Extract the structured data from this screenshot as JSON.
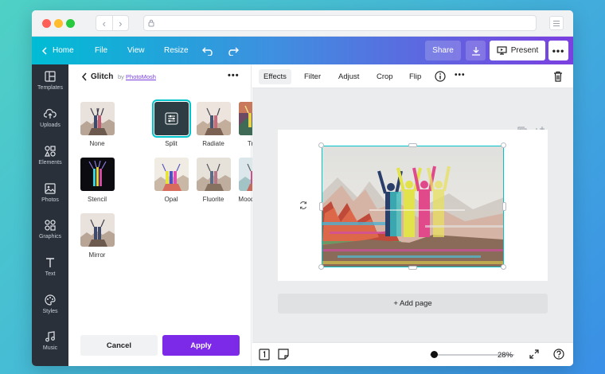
{
  "colors": {
    "accent_purple": "#7d2ae8",
    "selection_teal": "#00c4cc",
    "rail_bg": "#293039"
  },
  "topbar": {
    "home_label": "Home",
    "file_label": "File",
    "view_label": "View",
    "resize_label": "Resize",
    "share_label": "Share",
    "present_label": "Present"
  },
  "sidebar": {
    "items": [
      {
        "label": "Templates",
        "icon": "layout-icon"
      },
      {
        "label": "Uploads",
        "icon": "cloud-upload-icon"
      },
      {
        "label": "Elements",
        "icon": "shapes-icon"
      },
      {
        "label": "Photos",
        "icon": "image-icon"
      },
      {
        "label": "Graphics",
        "icon": "graphics-icon"
      },
      {
        "label": "Text",
        "icon": "text-icon"
      },
      {
        "label": "Styles",
        "icon": "palette-icon"
      },
      {
        "label": "Music",
        "icon": "music-note-icon"
      }
    ]
  },
  "panel": {
    "title": "Glitch",
    "by": "by",
    "author": "PhotoMosh",
    "effects": [
      {
        "label": "None"
      },
      {
        "label": "Split"
      },
      {
        "label": "Radiate"
      },
      {
        "label": "Trace"
      },
      {
        "label": "Stencil"
      },
      {
        "label": "Opal"
      },
      {
        "label": "Fluorite"
      },
      {
        "label": "Mood Stone"
      },
      {
        "label": "Mirror"
      }
    ],
    "selected_effect": "Split",
    "cancel_label": "Cancel",
    "apply_label": "Apply"
  },
  "toolbar": {
    "effects_label": "Effects",
    "filter_label": "Filter",
    "adjust_label": "Adjust",
    "crop_label": "Crop",
    "flip_label": "Flip"
  },
  "canvas": {
    "add_page_label": "+ Add page",
    "zoom_label": "28%",
    "zoom_fraction": 0.05
  }
}
